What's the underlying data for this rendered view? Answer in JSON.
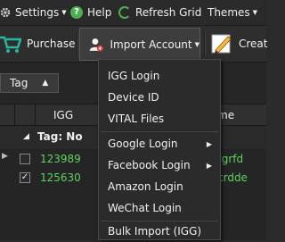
{
  "menubar": {
    "settings": "Settings",
    "help": "Help",
    "refresh": "Refresh Grid",
    "themes": "Themes"
  },
  "toolbar": {
    "purchase": "Purchase",
    "import_account": "Import Account",
    "create_partial": "Creat"
  },
  "tag_filter": {
    "label": "Tag"
  },
  "grid": {
    "columns": [
      "IGG",
      "me"
    ],
    "group_label": "Tag: No",
    "rows": [
      {
        "igg": "123989",
        "name": "tgrfd",
        "checked": false
      },
      {
        "igg": "125630",
        "name": "crdde",
        "checked": true
      }
    ]
  },
  "import_menu": {
    "items": [
      {
        "label": "IGG Login",
        "submenu": false
      },
      {
        "label": "Device ID",
        "submenu": false
      },
      {
        "label": "VITAL Files",
        "submenu": false
      },
      {
        "label": "Google Login",
        "submenu": true
      },
      {
        "label": "Facebook Login",
        "submenu": true
      },
      {
        "label": "Amazon Login",
        "submenu": false
      },
      {
        "label": "WeChat Login",
        "submenu": false
      },
      {
        "label": "Bulk Import (IGG)",
        "submenu": false
      }
    ]
  },
  "colors": {
    "accent_green": "#5fd35f",
    "import_icon_badge": "#e03a3a"
  }
}
